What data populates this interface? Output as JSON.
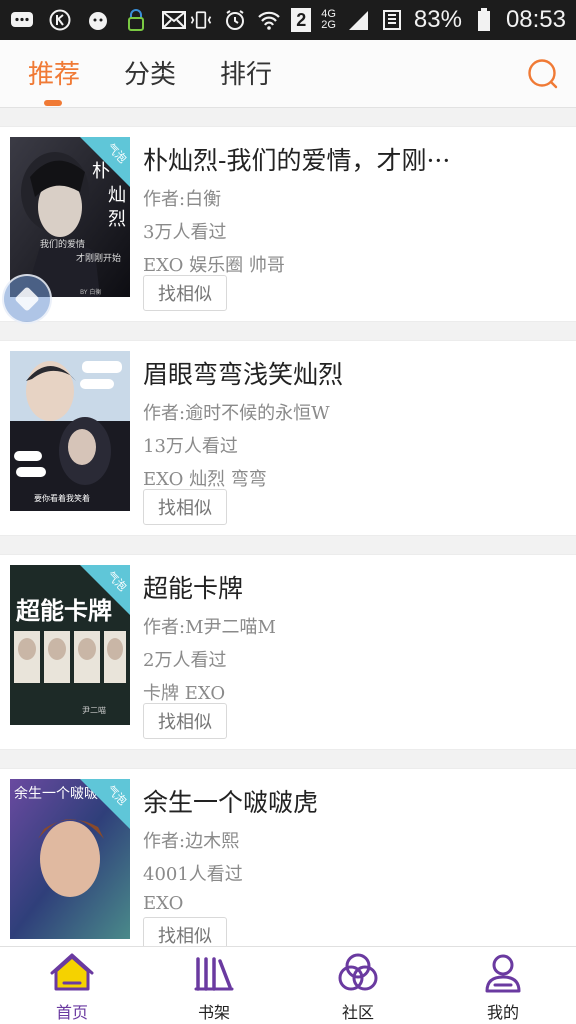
{
  "status_bar": {
    "signal_label_top": "4G",
    "signal_label_bottom": "2G",
    "sim_label": "2",
    "battery": "83%",
    "time": "08:53"
  },
  "tabs": [
    {
      "label": "推荐",
      "active": true
    },
    {
      "label": "分类",
      "active": false
    },
    {
      "label": "排行",
      "active": false
    }
  ],
  "books": [
    {
      "title": "朴灿烈-我们的爱情，才刚···",
      "author": "作者:白衡",
      "views": "3万人看过",
      "tags": "EXO 娱乐圈 帅哥",
      "similar_label": "找相似",
      "badge": "气泡",
      "cover_text": [
        "朴",
        "灿",
        "烈",
        "我们的爱情",
        "才刚刚开始",
        "BY 白衡"
      ]
    },
    {
      "title": "眉眼弯弯浅笑灿烈",
      "author": "作者:逾时不候的永恒W",
      "views": "13万人看过",
      "tags": "EXO 灿烈 弯弯",
      "similar_label": "找相似",
      "badge": "",
      "cover_text": [
        "要你看着我笑着"
      ]
    },
    {
      "title": "超能卡牌",
      "author": "作者:M尹二喵M",
      "views": "2万人看过",
      "tags": " 卡牌 EXO",
      "similar_label": "找相似",
      "badge": "气泡",
      "cover_text": [
        "超能卡牌",
        "尹二喵"
      ]
    },
    {
      "title": "余生一个啵啵虎",
      "author": "作者:边木熙",
      "views": "4001人看过",
      "tags": "EXO",
      "similar_label": "找相似",
      "badge": "气泡",
      "cover_text": [
        "余生一个啵啵"
      ]
    }
  ],
  "bottom_nav": [
    {
      "label": "首页",
      "icon": "home-icon",
      "active": true
    },
    {
      "label": "书架",
      "icon": "bookshelf-icon",
      "active": false
    },
    {
      "label": "社区",
      "icon": "community-icon",
      "active": false
    },
    {
      "label": "我的",
      "icon": "profile-icon",
      "active": false
    }
  ],
  "colors": {
    "accent": "#f07a35",
    "nav_active": "#6a3aa0",
    "badge": "#5fc6d8"
  }
}
